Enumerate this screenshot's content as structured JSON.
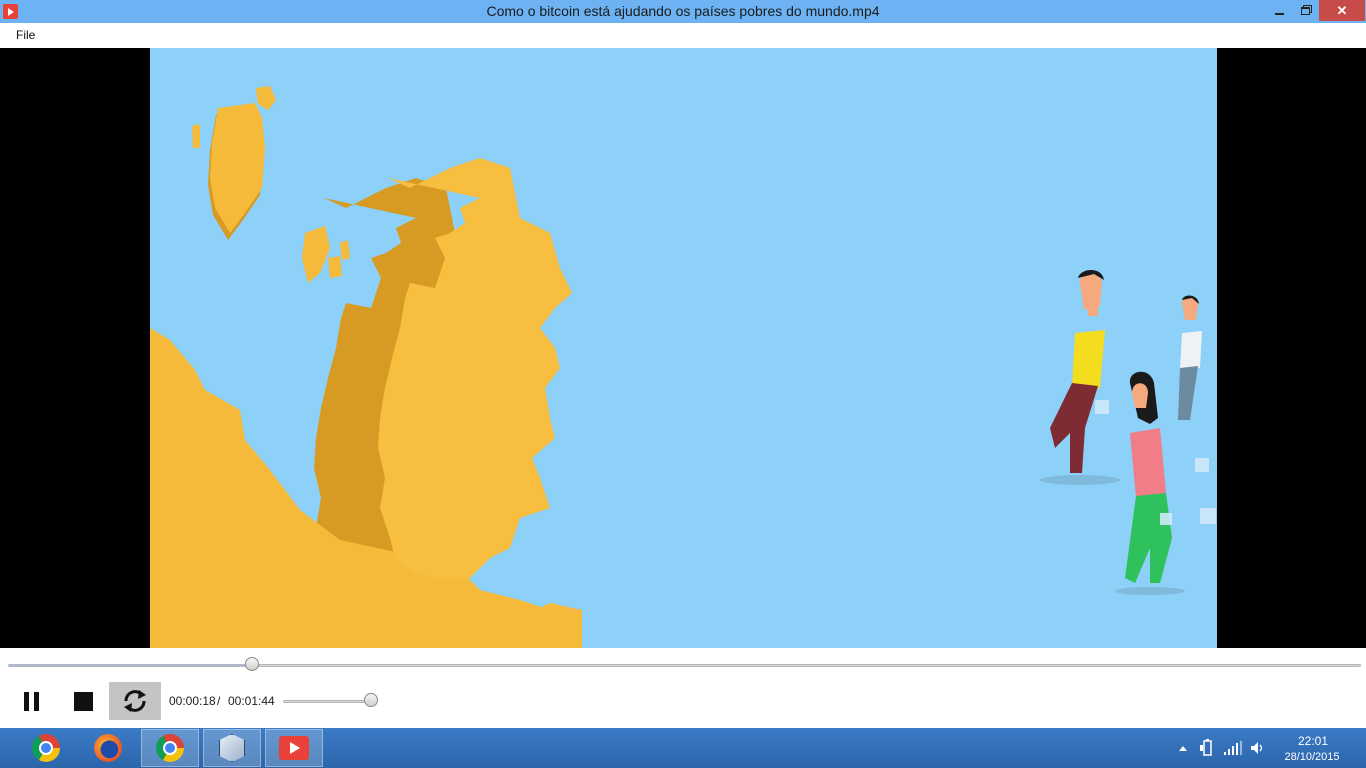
{
  "window": {
    "title": "Como o bitcoin está ajudando os países pobres do mundo.mp4",
    "close_glyph": "✕"
  },
  "menu": {
    "file": "File"
  },
  "player": {
    "current_time": "00:00:18",
    "separator": "/",
    "total_time": "00:01:44",
    "seek_progress": 0.18,
    "volume": 1.0
  },
  "taskbar": {
    "apps": [
      {
        "name": "chrome",
        "icon": "chrome-icon"
      },
      {
        "name": "firefox",
        "icon": "firefox-icon"
      },
      {
        "name": "chrome",
        "icon": "chrome-icon"
      },
      {
        "name": "virtualbox",
        "icon": "box-icon"
      },
      {
        "name": "video-player",
        "icon": "player-icon"
      }
    ],
    "clock": {
      "time": "22:01",
      "date": "28/10/2015"
    }
  },
  "colors": {
    "titlebar": "#6db2f2",
    "close": "#c74b49",
    "sky": "#8dd0f8",
    "land": "#f5ba3a",
    "taskbar": "#2d6bb6"
  }
}
